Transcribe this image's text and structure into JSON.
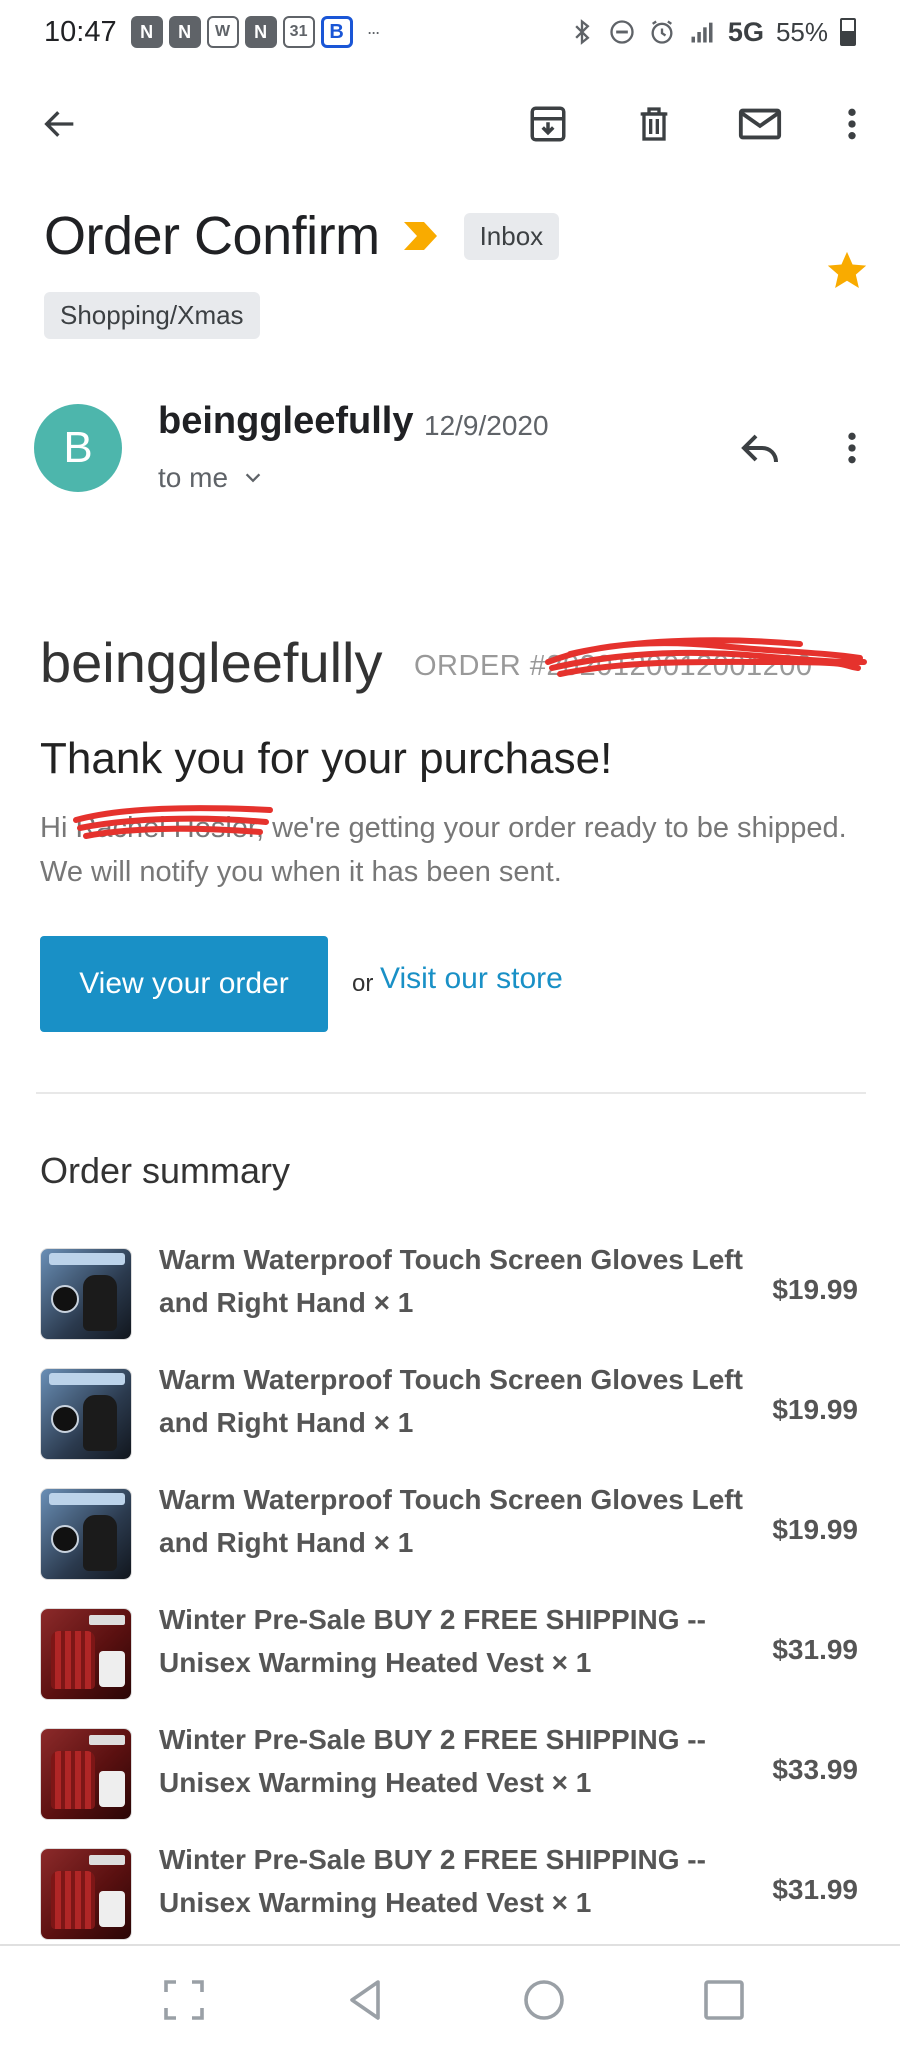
{
  "status_bar": {
    "time": "10:47",
    "network": "5G",
    "battery": "55%",
    "notif_icons": [
      "N",
      "N",
      "W",
      "N",
      "31",
      "B"
    ],
    "notif_more": "···"
  },
  "app_bar": {
    "icons": [
      "back-arrow-icon",
      "archive-icon",
      "delete-icon",
      "mark-unread-icon",
      "more-vert-icon"
    ]
  },
  "email": {
    "subject": "Order Confirm",
    "inbox_chip": "Inbox",
    "label_chip": "Shopping/Xmas",
    "starred": true,
    "star_color": "#f9ab00",
    "sender": {
      "avatar_letter": "B",
      "avatar_color": "#4db6ac",
      "name": "beinggleefully",
      "date": "12/9/2020",
      "recipient": "to me"
    }
  },
  "body": {
    "shop_name": "beinggleefully",
    "order_number": "ORDER #2020120012001200",
    "thanks_heading": "Thank you for your purchase!",
    "greeting_prefix": "Hi ",
    "greeting_name": "Rachel Hosler",
    "greeting_rest": ", we're getting your order ready to be shipped. We will notify you when it has been sent.",
    "view_order_button": "View your order",
    "or_text": "or",
    "visit_store_link": "Visit our store",
    "order_summary_title": "Order summary",
    "accent_color": "#1990c6"
  },
  "items": [
    {
      "name": "Warm Waterproof Touch Screen Gloves Left and Right Hand × 1",
      "price": "$19.99",
      "thumb": "gloves"
    },
    {
      "name": "Warm Waterproof Touch Screen Gloves Left and Right Hand × 1",
      "price": "$19.99",
      "thumb": "gloves"
    },
    {
      "name": "Warm Waterproof Touch Screen Gloves Left and Right Hand × 1",
      "price": "$19.99",
      "thumb": "gloves"
    },
    {
      "name": "Winter Pre-Sale BUY 2 FREE SHIPPING -- Unisex Warming Heated Vest × 1",
      "price": "$31.99",
      "thumb": "vest"
    },
    {
      "name": "Winter Pre-Sale BUY 2 FREE SHIPPING -- Unisex Warming Heated Vest × 1",
      "price": "$33.99",
      "thumb": "vest"
    },
    {
      "name": "Winter Pre-Sale BUY 2 FREE SHIPPING -- Unisex Warming Heated Vest × 1",
      "price": "$31.99",
      "thumb": "vest"
    }
  ],
  "nav_bar": {
    "icons": [
      "screenshot-icon",
      "back-icon",
      "home-icon",
      "recents-icon"
    ]
  }
}
